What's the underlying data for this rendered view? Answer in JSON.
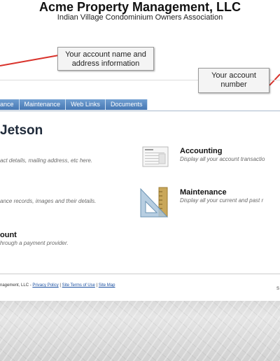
{
  "header": {
    "company": "Acme Property Management, LLC",
    "association": "Indian Village Condominium Owners Association"
  },
  "callouts": {
    "account_info": "Your account name and address information",
    "account_number": "Your account number"
  },
  "nav": {
    "tabs": [
      {
        "label": "ance"
      },
      {
        "label": "Maintenance"
      },
      {
        "label": "Web Links"
      },
      {
        "label": "Documents"
      }
    ]
  },
  "owner": {
    "name": "Jetson"
  },
  "items": {
    "contact_desc": "act details, mailing address, etc here.",
    "maintenance_records_desc": "ance records, images and their details.",
    "account_title": "ount",
    "account_desc": "hrough a payment provider.",
    "accounting": {
      "title": "Accounting",
      "desc": "Display all your account transactio"
    },
    "maintenance": {
      "title": "Maintenance",
      "desc": "Display all your current and past r"
    }
  },
  "footer": {
    "prefix": "nagement, LLC  -",
    "privacy": "Privacy Policy",
    "terms": "Site Terms of Use",
    "sitemap": "Site Map",
    "sep": "|",
    "right": "S"
  },
  "colors": {
    "tab_bg": "#4677b3",
    "owner_name": "#1f2a3a",
    "arrow": "#d9322b"
  }
}
